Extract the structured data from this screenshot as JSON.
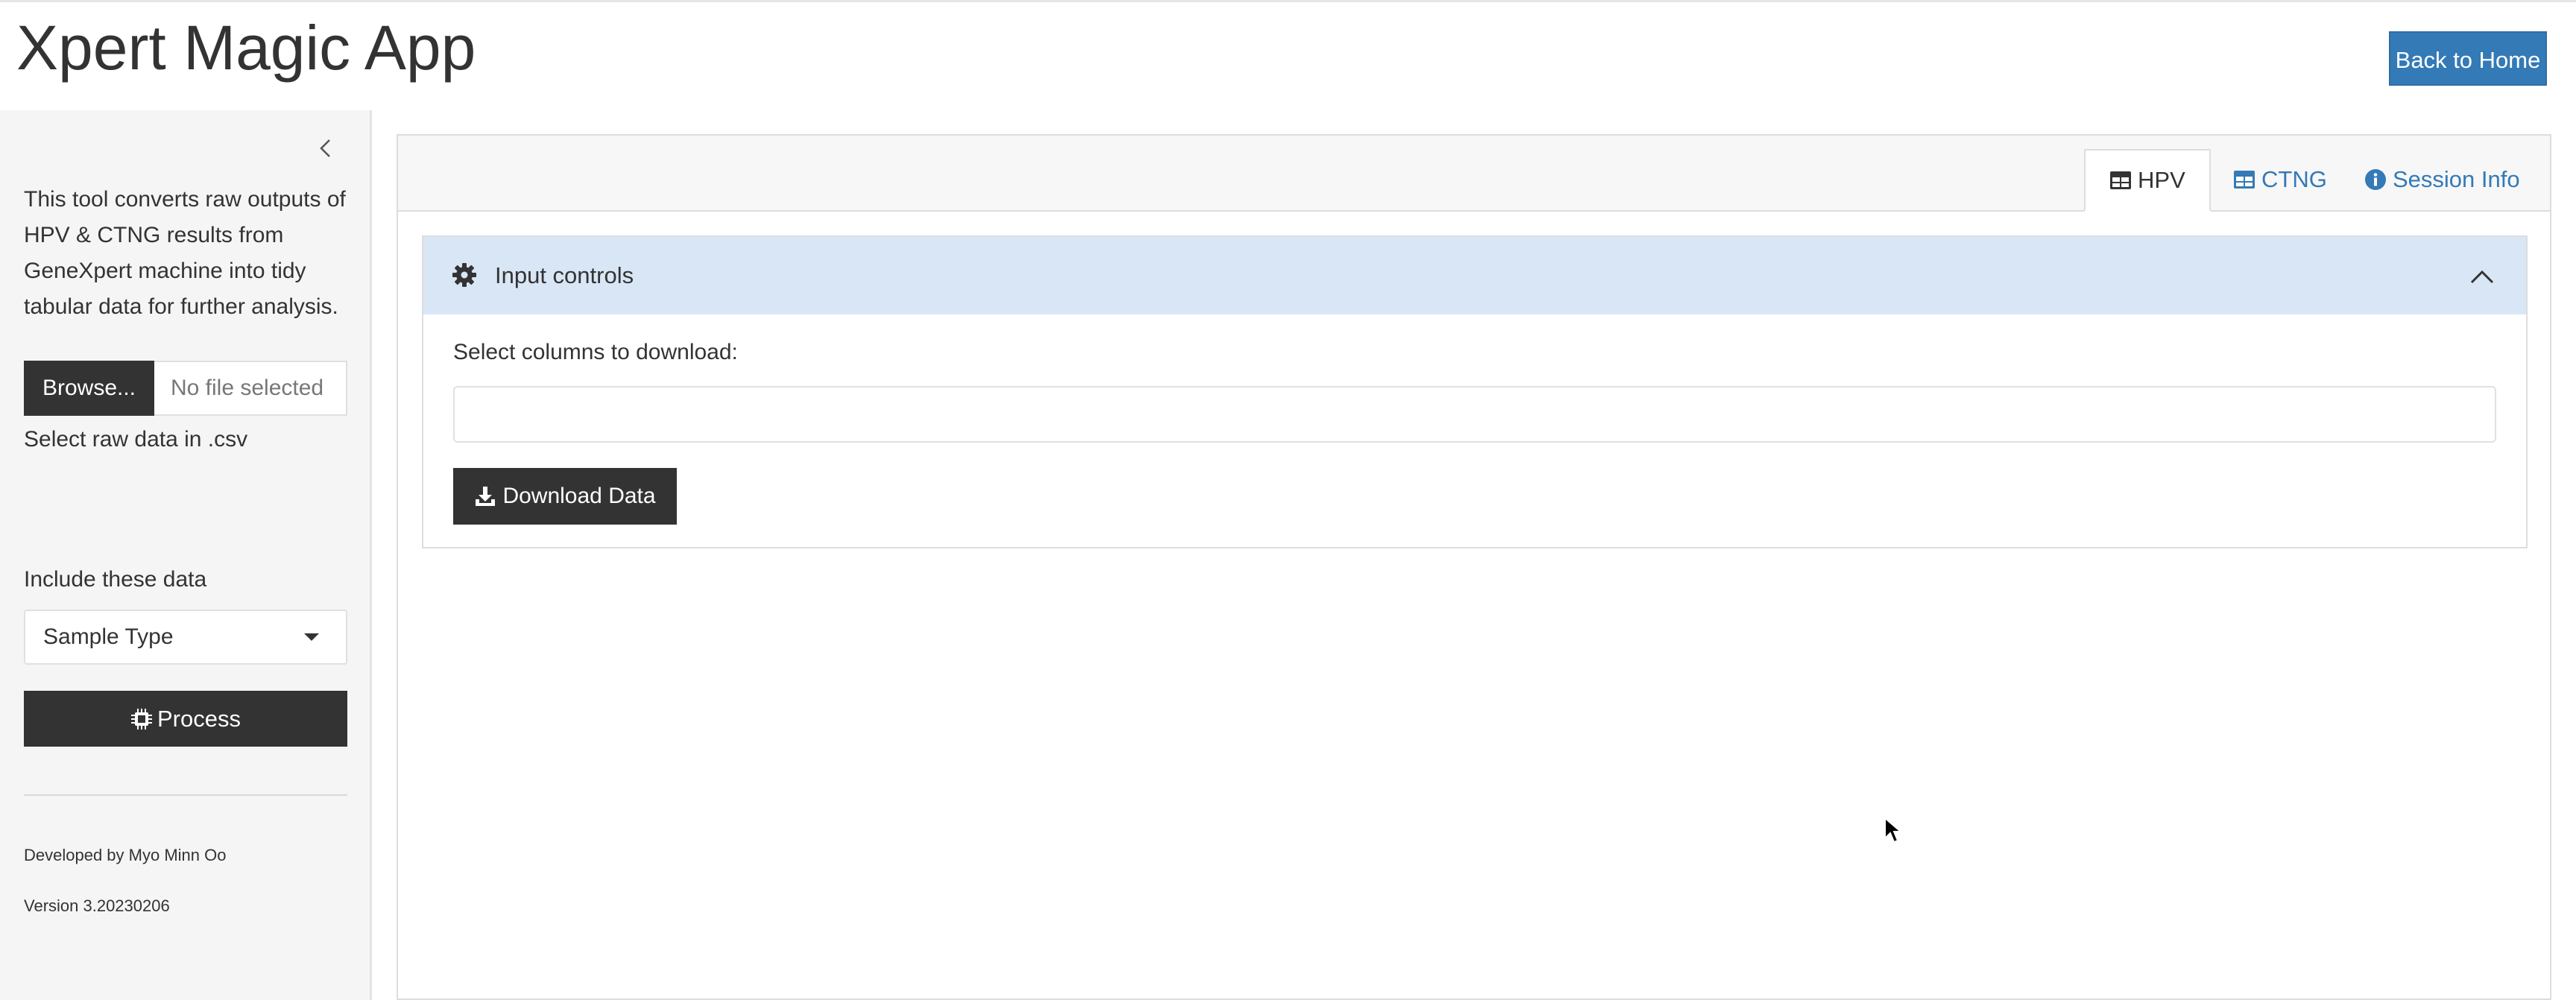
{
  "app": {
    "title": "Xpert Magic App",
    "back_button": "Back to Home"
  },
  "sidebar": {
    "description": "This tool converts raw outputs of HPV & CTNG results from GeneXpert machine into tidy tabular data for further analysis.",
    "file_input": {
      "label": "Select raw data in .csv",
      "browse_label": "Browse...",
      "file_status": "No file selected"
    },
    "include": {
      "label": "Include these data",
      "selected": "Sample Type"
    },
    "process_label": "Process",
    "developer": "Developed by Myo Minn Oo",
    "version": "Version 3.20230206"
  },
  "tabs": [
    {
      "label": "HPV",
      "icon": "table-icon",
      "active": true
    },
    {
      "label": "CTNG",
      "icon": "table-icon",
      "active": false
    },
    {
      "label": "Session Info",
      "icon": "info-circle-icon",
      "active": false
    }
  ],
  "input_controls": {
    "title": "Input controls",
    "columns_label": "Select columns to download:",
    "columns_value": "",
    "download_label": "Download Data"
  },
  "colors": {
    "primary": "#337ab7",
    "dark": "#333333",
    "panel_header": "#d9e6f5",
    "sidebar_bg": "#f5f5f5"
  }
}
